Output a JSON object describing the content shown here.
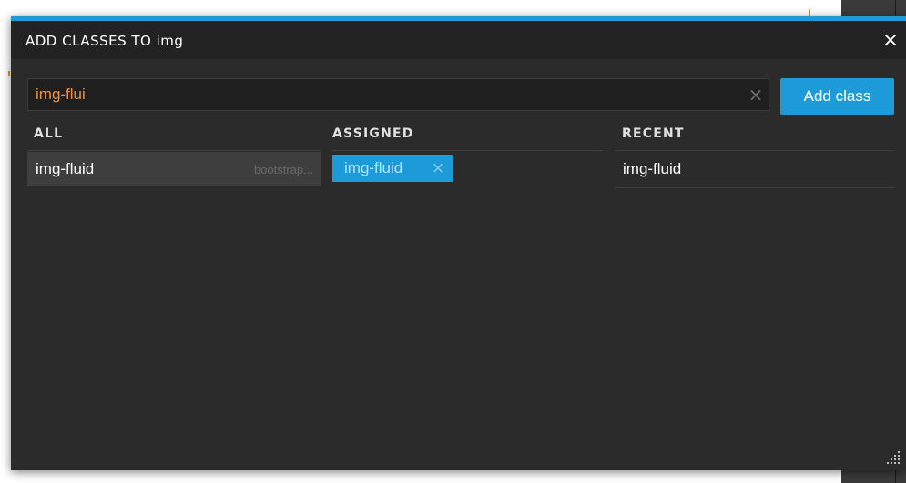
{
  "dialog": {
    "title": "ADD CLASSES TO img",
    "close_icon": "×"
  },
  "search": {
    "value": "img-flui",
    "clear_icon": "×"
  },
  "add_button": {
    "label": "Add class"
  },
  "columns": {
    "all": {
      "header": "ALL",
      "items": [
        {
          "name": "img-fluid",
          "source": "bootstrap..."
        }
      ]
    },
    "assigned": {
      "header": "ASSIGNED",
      "items": [
        {
          "name": "img-fluid",
          "remove_icon": "×"
        }
      ]
    },
    "recent": {
      "header": "RECENT",
      "items": [
        {
          "name": "img-fluid"
        }
      ]
    }
  },
  "colors": {
    "accent": "#1d9bd8",
    "search_text": "#e8904a",
    "dialog_bg": "#2b2b2b",
    "header_bg": "#222222"
  },
  "icons": [
    "close-icon",
    "clear-search-icon",
    "tag-remove-icon",
    "resize-grip-icon"
  ]
}
